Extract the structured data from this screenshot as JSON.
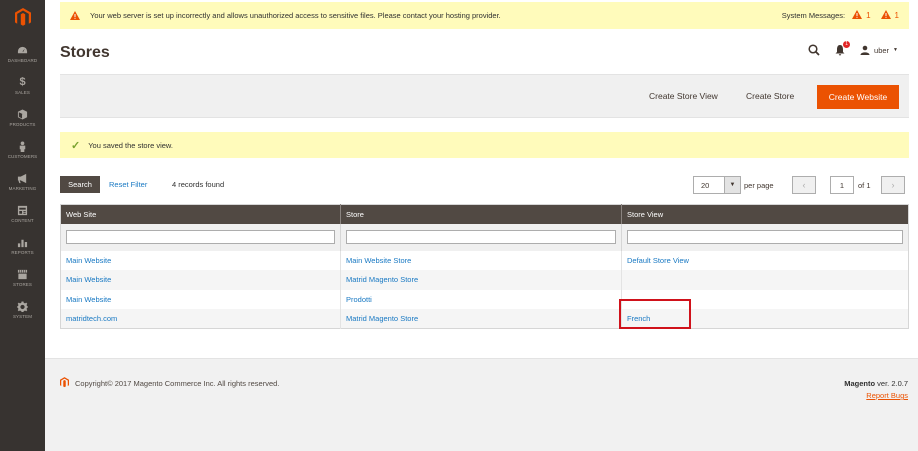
{
  "sidebar": {
    "items": [
      {
        "label": "DASHBOARD",
        "icon": "dashboard-icon"
      },
      {
        "label": "SALES",
        "icon": "dollar-icon"
      },
      {
        "label": "PRODUCTS",
        "icon": "cube-icon"
      },
      {
        "label": "CUSTOMERS",
        "icon": "person-icon"
      },
      {
        "label": "MARKETING",
        "icon": "megaphone-icon"
      },
      {
        "label": "CONTENT",
        "icon": "content-icon"
      },
      {
        "label": "REPORTS",
        "icon": "bar-chart-icon"
      },
      {
        "label": "STORES",
        "icon": "store-icon"
      },
      {
        "label": "SYSTEM",
        "icon": "gear-icon"
      }
    ]
  },
  "system_bar": {
    "message": "Your web server is set up incorrectly and allows unauthorized access to sensitive files. Please contact your hosting provider.",
    "label": "System Messages:",
    "count_1": "1",
    "count_2": "1"
  },
  "header": {
    "title": "Stores",
    "user": "uber",
    "notifications": "1"
  },
  "actions": {
    "create_store_view": "Create Store View",
    "create_store": "Create Store",
    "create_website": "Create Website"
  },
  "success": {
    "message": "You saved the store view."
  },
  "grid_controls": {
    "search": "Search",
    "reset": "Reset Filter",
    "records": "4 records found",
    "per_page_value": "20",
    "per_page_label": "per page",
    "page": "1",
    "of": "of 1"
  },
  "grid": {
    "columns": [
      "Web Site",
      "Store",
      "Store View"
    ],
    "rows": [
      [
        "Main Website",
        "Main Website Store",
        "Default Store View"
      ],
      [
        "Main Website",
        "Matrid Magento Store",
        ""
      ],
      [
        "Main Website",
        "Prodotti",
        ""
      ],
      [
        "matridtech.com",
        "Matrid Magento Store",
        "French"
      ]
    ]
  },
  "footer": {
    "copyright": "Copyright© 2017 Magento Commerce Inc. All rights reserved.",
    "brand": "Magento",
    "version": " ver. 2.0.7",
    "report": "Report Bugs"
  },
  "colors": {
    "accent": "#eb5202",
    "sidebar": "#373330",
    "link": "#1979c3",
    "notice": "#fffbbb",
    "highlight": "#d0121b"
  }
}
